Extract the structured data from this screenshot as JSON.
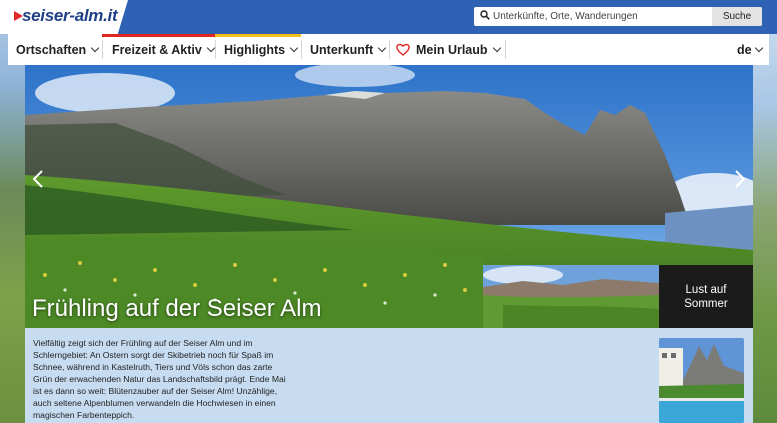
{
  "site": {
    "logo_text": "seiser-alm.it"
  },
  "search": {
    "placeholder": "Unterkünfte, Orte, Wanderungen",
    "button_label": "Suche"
  },
  "nav": {
    "items": [
      {
        "label": "Ortschaften",
        "accent": "#ffffff"
      },
      {
        "label": "Freizeit & Aktiv",
        "accent": "#e0261f"
      },
      {
        "label": "Highlights",
        "accent": "#f2c018"
      },
      {
        "label": "Unterkunft",
        "accent": "#ffffff"
      },
      {
        "label": "Mein Urlaub",
        "accent": "#ffffff"
      }
    ],
    "language": "de"
  },
  "hero": {
    "title": "Frühling auf der Seiser Alm",
    "next_slide_label": "Lust auf Sommer",
    "next_slide_line1": "Lust auf",
    "next_slide_line2": "Sommer"
  },
  "content": {
    "paragraph": "Vielfältig zeigt sich der Frühling auf der Seiser Alm und im Schlerngebiet: An Ostern sorgt der Skibetrieb noch für Spaß im Schnee, während in Kastelruth, Tiers und Völs schon das zarte Grün der erwachenden Natur das Landschaftsbild prägt. Ende Mai ist es dann so weit: Blütenzauber auf der Seiser Alm! Unzählige, auch seltene Alpenblumen verwandeln die Hochwiesen in einen magischen Farbenteppich."
  },
  "colors": {
    "header_blue": "#2f62b5",
    "logo_blue": "#1f3f86",
    "content_bg": "#c7dcf1",
    "heart_red": "#e0261f"
  }
}
